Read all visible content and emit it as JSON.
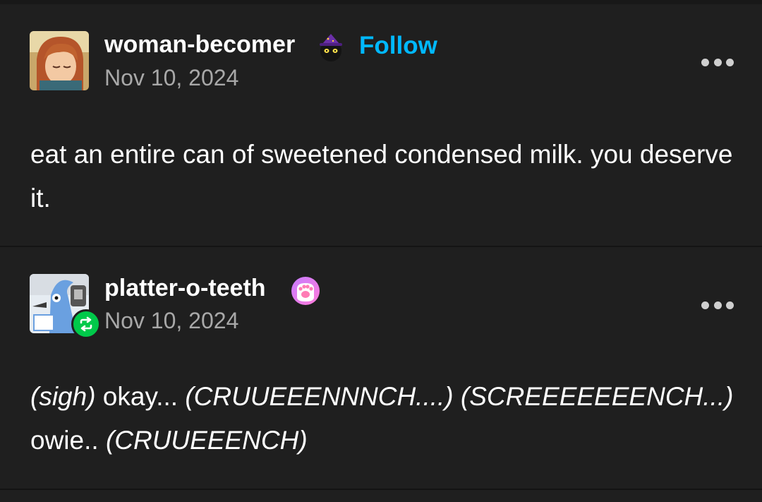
{
  "posts": [
    {
      "username": "woman-becomer",
      "follow_label": "Follow",
      "date": "Nov 10, 2024",
      "badge_icon": "witch-cat-icon",
      "text": "eat an entire can of sweetened condensed milk. you deserve it."
    },
    {
      "username": "platter-o-teeth",
      "date": "Nov 10, 2024",
      "badge_icon": "paw-icon",
      "reblog_icon": "reblog-icon",
      "text_parts": [
        {
          "text": "(sigh)",
          "italic": true
        },
        {
          "text": " okay... ",
          "italic": false
        },
        {
          "text": "(CRUUEEENNNCH....)",
          "italic": true
        },
        {
          "text": " ",
          "italic": false
        },
        {
          "text": "(SCREEEEEEENCH...)",
          "italic": true
        },
        {
          "text": " owie.. ",
          "italic": false
        },
        {
          "text": "(CRUUEEENCH)",
          "italic": true
        }
      ]
    }
  ],
  "colors": {
    "background": "#1f1f1f",
    "follow": "#00b8ff",
    "date": "#a8a8a8",
    "reblog": "#00c94a"
  }
}
